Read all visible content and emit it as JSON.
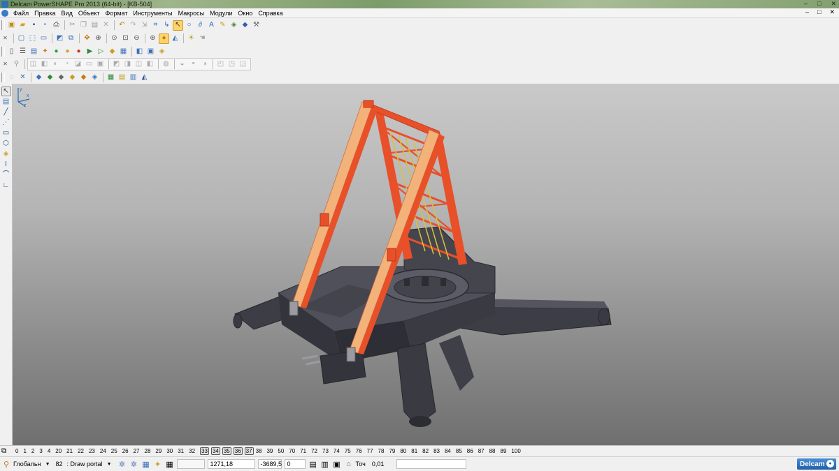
{
  "window": {
    "title": "Delcam PowerSHAPE Pro 2013 (64-bit) - [KB-504]",
    "buttons": [
      "–",
      "□",
      "✕"
    ]
  },
  "menu": {
    "items": [
      "Файл",
      "Правка",
      "Вид",
      "Объект",
      "Формат",
      "Инструменты",
      "Макросы",
      "Модули",
      "Окно",
      "Справка"
    ],
    "mdi_buttons": [
      "–",
      "□",
      "✕"
    ]
  },
  "toolbars": {
    "row1_icons": [
      "open-icon",
      "open-folder-icon",
      "save-icon",
      "save-as-icon",
      "print-icon",
      "cut-icon",
      "copy-icon",
      "paste-icon",
      "delete-icon",
      "undo-icon",
      "redo-icon",
      "select-icon",
      "measure-icon",
      "rotate-icon",
      "circle-icon",
      "zoom-icon",
      "pen-icon",
      "light-icon",
      "settings-icon"
    ],
    "row2_icons": [
      "box-icon",
      "cube-front-icon",
      "cube-top-icon",
      "layers-icon",
      "zoom-in-icon",
      "zoom-out-icon",
      "zoom-fit-icon",
      "zoom-box-icon",
      "globe-icon",
      "shading-icon",
      "wireframe-icon",
      "render-icon",
      "pan-icon"
    ],
    "row3_icons": [
      "doc-icon",
      "list-icon",
      "paint-icon",
      "sphere-green-icon",
      "sphere-red-icon",
      "sphere-yellow-icon",
      "play-icon",
      "arrow-icon",
      "surface-icon",
      "grid-icon",
      "attribute-icon",
      "export-icon"
    ],
    "row4_icons": [
      "solid-icon",
      "extrude-icon",
      "revolve-icon",
      "fillet-icon",
      "chamfer-icon",
      "shell-icon",
      "boolean-icon",
      "cut-solid-icon",
      "union-icon",
      "feature-icon"
    ],
    "row5_icons": [
      "sketch-icon",
      "line-icon",
      "arc-icon",
      "curve-icon",
      "spline-icon",
      "polyline-icon",
      "text-icon",
      "dimension-icon",
      "hatch-icon",
      "symbol-icon"
    ]
  },
  "left_toolbar": {
    "icons": [
      "pointer-icon",
      "multi-select-icon",
      "line-tool-icon",
      "polyline-tool-icon",
      "rectangle-tool-icon",
      "polygon-tool-icon",
      "solid-tool-icon",
      "i-beam-tool-icon",
      "curve-tool-icon",
      "dimension-tool-icon"
    ]
  },
  "viewport": {
    "axis_labels": {
      "x": "x",
      "y": "y",
      "z": "z"
    },
    "colors": {
      "frame_orange": "#e8502a",
      "frame_light": "#f2b27a",
      "ladder_yellow": "#d8c23a",
      "base_dark": "#3a3a42"
    }
  },
  "levels": {
    "items": [
      "0",
      "1",
      "2",
      "3",
      "4",
      "20",
      "21",
      "22",
      "23",
      "24",
      "25",
      "26",
      "27",
      "28",
      "29",
      "30",
      "31",
      "32",
      "33",
      "34",
      "35",
      "36",
      "37",
      "38",
      "39",
      "50",
      "70",
      "71",
      "72",
      "73",
      "74",
      "75",
      "76",
      "77",
      "78",
      "79",
      "80",
      "81",
      "82",
      "83",
      "84",
      "85",
      "86",
      "87",
      "88",
      "89",
      "100"
    ],
    "boxed": [
      "33",
      "34",
      "35",
      "36",
      "37"
    ]
  },
  "status": {
    "workplane": "Глобальн",
    "level_number": "82",
    "level_name": ": Draw portal",
    "coord_x": "1271,18",
    "coord_y": "-3689,5",
    "coord_z": "0",
    "tolerance_label": "Точ",
    "tolerance_value": "0,01",
    "logo": "Delcam"
  }
}
